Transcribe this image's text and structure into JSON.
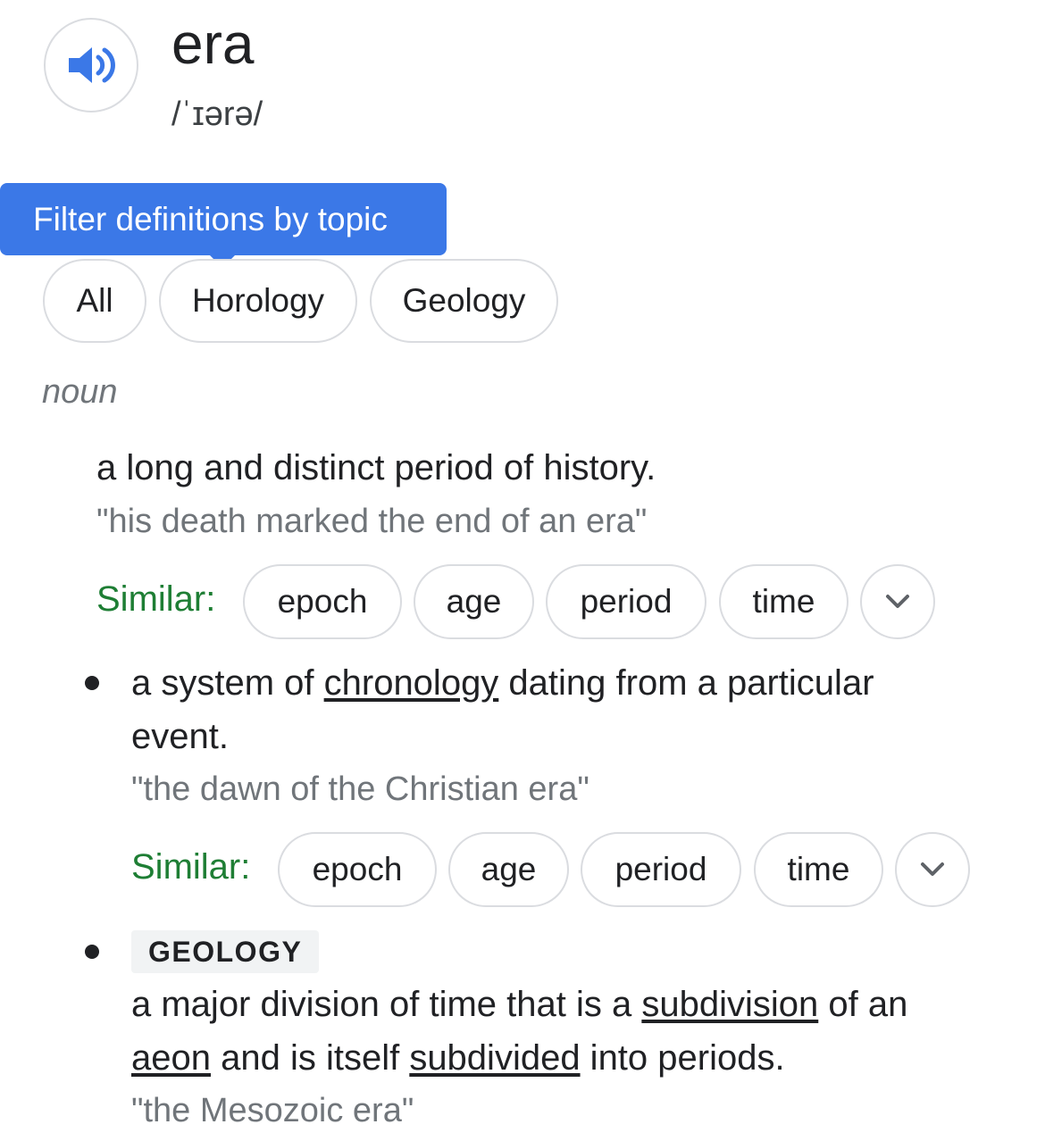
{
  "header": {
    "word": "era",
    "phonetic": "/ˈɪərə/",
    "speaker_icon": "speaker-volume-icon",
    "accent_color": "#3b78e7"
  },
  "tooltip": {
    "text": "Filter definitions by topic"
  },
  "topics": [
    "All",
    "Horology",
    "Geology"
  ],
  "part_of_speech": "noun",
  "definitions": [
    {
      "text": "a long and distinct period of history.",
      "example": "\"his death marked the end of an era\"",
      "similar_label": "Similar:",
      "similar": [
        "epoch",
        "age",
        "period",
        "time"
      ]
    },
    {
      "text_parts": [
        "a system of ",
        "chronology",
        " dating from a particular event."
      ],
      "example": "\"the dawn of the Christian era\"",
      "similar_label": "Similar:",
      "similar": [
        "epoch",
        "age",
        "period",
        "time"
      ]
    },
    {
      "label": "GEOLOGY",
      "text_parts": [
        "a major division of time that is a ",
        "subdivision",
        " of an ",
        "aeon",
        " and is itself ",
        "subdivided",
        " into periods."
      ],
      "example": "\"the Mesozoic era\""
    }
  ],
  "colors": {
    "similar": "#1e7e34",
    "example": "#70757a",
    "chip_border": "#dadce0"
  }
}
